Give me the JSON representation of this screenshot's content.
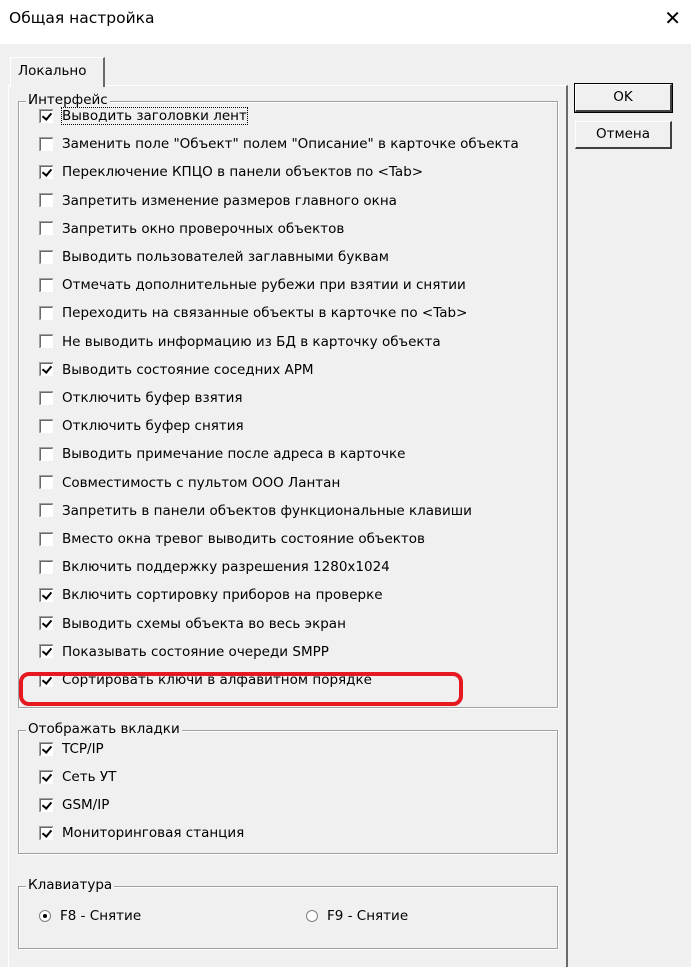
{
  "window": {
    "title": "Общая настройка"
  },
  "tab": {
    "label": "Локально"
  },
  "buttons": {
    "ok": "OK",
    "cancel": "Отмена"
  },
  "interface": {
    "title": "Интерфейс",
    "items": [
      {
        "label": "Выводить заголовки лент",
        "checked": true
      },
      {
        "label": "Заменить поле \"Объект\" полем \"Описание\" в карточке объекта",
        "checked": false
      },
      {
        "label": "Переключение КПЦО в панели объектов по <Tab>",
        "checked": true
      },
      {
        "label": "Запретить изменение размеров главного окна",
        "checked": false
      },
      {
        "label": "Запретить окно проверочных объектов",
        "checked": false
      },
      {
        "label": "Выводить пользователей заглавными буквам",
        "checked": false
      },
      {
        "label": "Отмечать дополнительные рубежи при взятии и снятии",
        "checked": false
      },
      {
        "label": "Переходить на связанные объекты в карточке по <Tab>",
        "checked": false
      },
      {
        "label": "Не выводить информацию из БД в карточку объекта",
        "checked": false
      },
      {
        "label": "Выводить состояние соседних АРМ",
        "checked": true
      },
      {
        "label": "Отключить буфер взятия",
        "checked": false
      },
      {
        "label": "Отключить буфер снятия",
        "checked": false
      },
      {
        "label": "Выводить примечание после адреса в карточке",
        "checked": false
      },
      {
        "label": "Совместимость с пультом ООО Лантан",
        "checked": false
      },
      {
        "label": "Запретить в панели объектов функциональные клавиши",
        "checked": false
      },
      {
        "label": "Вместо окна тревог выводить состояние объектов",
        "checked": false
      },
      {
        "label": "Включить поддержку разрешения 1280x1024",
        "checked": false
      },
      {
        "label": "Включить сортировку приборов на проверке",
        "checked": true
      },
      {
        "label": "Выводить схемы объекта во весь экран",
        "checked": true
      },
      {
        "label": "Показывать состояние очереди SMPP",
        "checked": true
      },
      {
        "label": "Сортировать ключи в алфавитном порядке",
        "checked": true
      }
    ]
  },
  "tabs_group": {
    "title": "Отображать вкладки",
    "items": [
      {
        "label": "TCP/IP",
        "checked": true
      },
      {
        "label": "Сеть УТ",
        "checked": true
      },
      {
        "label": "GSM/IP",
        "checked": true
      },
      {
        "label": "Мониторинговая станция",
        "checked": true
      }
    ]
  },
  "keyboard": {
    "title": "Клавиатура",
    "options": [
      {
        "label": "F8 - Снятие",
        "selected": true
      },
      {
        "label": "F9 - Снятие",
        "selected": false
      }
    ]
  },
  "colors": {
    "highlight": "#e5191f"
  }
}
